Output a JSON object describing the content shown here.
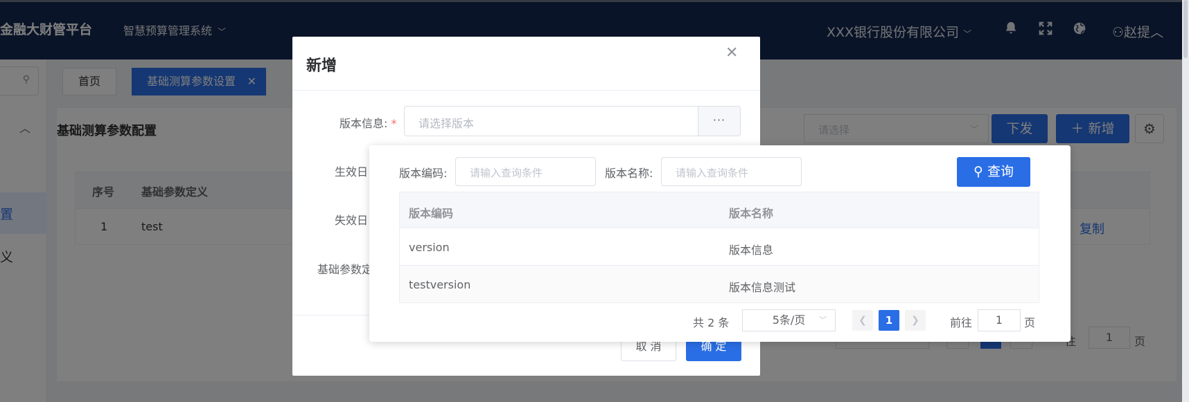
{
  "header": {
    "brand": "金融大财管平台",
    "system_name": "智慧预算管理系统",
    "company": "XXX银行股份有限公司",
    "user": "赵提",
    "icons": [
      "bell-icon",
      "fullscreen-icon",
      "globe-icon",
      "user-icon"
    ]
  },
  "sidebar": {
    "active_item": "置",
    "other_item": "义"
  },
  "tabs": {
    "home": "首页",
    "active": "基础测算参数设置",
    "close": "✕"
  },
  "page": {
    "title": "基础测算参数配置",
    "select_placeholder": "请选择",
    "issue_button": "下发",
    "add_button": "新增",
    "add_icon": "＋",
    "table": {
      "headers": [
        "序号",
        "基础参数定义"
      ],
      "rows": [
        {
          "index": "1",
          "definition": "test",
          "action": "复制"
        }
      ]
    },
    "pager": {
      "goto": "往",
      "page_value": "1",
      "page_unit": "页"
    }
  },
  "modal": {
    "title": "新增",
    "labels": {
      "version": "版本信息:",
      "effective": "生效日",
      "expire": "失效日",
      "param_def": "基础参数定"
    },
    "version_placeholder": "请选择版本",
    "more_button": "···",
    "cancel": "取 消",
    "ok": "确 定"
  },
  "popover": {
    "code_label": "版本编码:",
    "code_placeholder": "请输入查询条件",
    "name_label": "版本名称:",
    "name_placeholder": "请输入查询条件",
    "query_button": "查询",
    "table": {
      "headers": [
        "版本编码",
        "版本名称"
      ],
      "rows": [
        {
          "code": "version",
          "name": "版本信息"
        },
        {
          "code": "testversion",
          "name": "版本信息测试"
        }
      ]
    },
    "pager": {
      "total": "共 2 条",
      "page_size": "5条/页",
      "current": "1",
      "goto_label": "前往",
      "goto_value": "1",
      "page_unit": "页"
    }
  }
}
